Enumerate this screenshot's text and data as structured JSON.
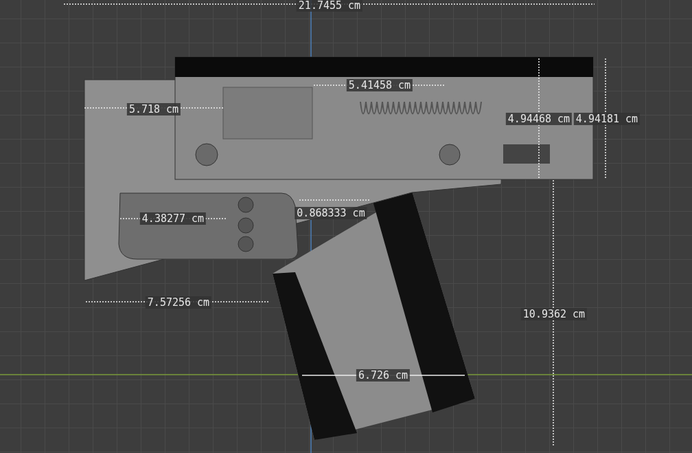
{
  "viewport": {
    "measurements": [
      {
        "kind": "horizontal",
        "reading": "21.7455 cm"
      },
      {
        "kind": "horizontal",
        "reading": "5.41458 cm"
      },
      {
        "kind": "horizontal",
        "reading": "5.718 cm"
      },
      {
        "kind": "vertical",
        "reading": "4.94468 cm"
      },
      {
        "kind": "vertical",
        "reading": "4.94181 cm"
      },
      {
        "kind": "horizontal",
        "reading": "4.38277 cm"
      },
      {
        "kind": "horizontal",
        "reading": "0.868333 cm"
      },
      {
        "kind": "horizontal",
        "reading": "7.57256 cm"
      },
      {
        "kind": "vertical",
        "reading": "10.9362 cm"
      },
      {
        "kind": "horizontal",
        "reading": "6.726 cm"
      }
    ]
  }
}
